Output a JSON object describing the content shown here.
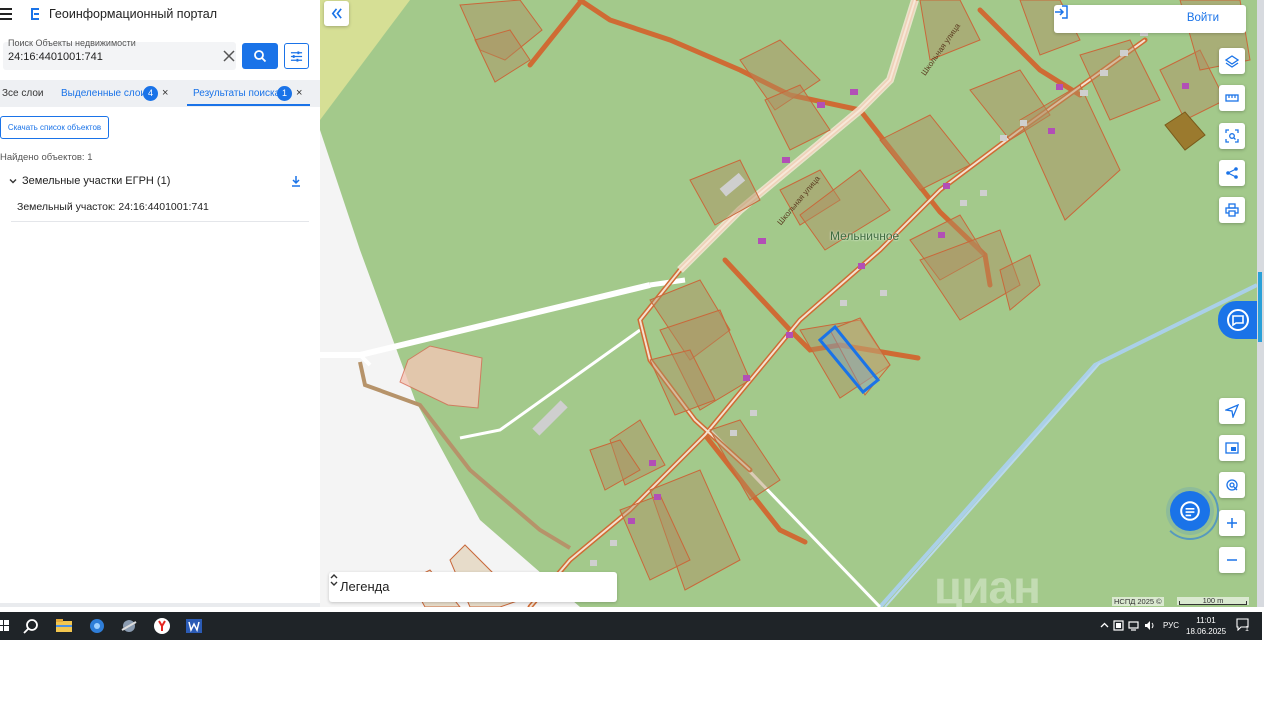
{
  "app": {
    "title": "Геоинформационный портал"
  },
  "search": {
    "label": "Поиск Объекты недвижимости",
    "value": "24:16:4401001:741"
  },
  "tabs": [
    {
      "label": "Зсе слои"
    },
    {
      "label": "Выделенные слои",
      "badge": "4"
    },
    {
      "label": "Результаты поиска",
      "badge": "1"
    }
  ],
  "results": {
    "download_list_label": "Скачать список объектов",
    "found_text": "Найдено объектов: 1",
    "group_label": "Земельные участки ЕГРН (1)",
    "items": [
      {
        "label": "Земельный участок: 24:16:4401001:741"
      }
    ]
  },
  "map": {
    "login_label": "Войти",
    "legend_label": "Легенда",
    "place_name": "Мельничное",
    "street_names": [
      "Школьная улица",
      "Школьная улица"
    ],
    "attribution": "НСПД 2025 ©",
    "scale_label": "100 m",
    "watermark": "циан",
    "tools": [
      "layers-icon",
      "ruler-icon",
      "select-area-icon",
      "share-icon",
      "print-icon",
      "locate-icon",
      "minimap-icon",
      "geo-search-icon",
      "zoom-in-icon",
      "zoom-out-icon"
    ],
    "colors": {
      "accent": "#1a73e8",
      "vegetation": "#a3c98b",
      "parcel": "#c9814f",
      "road": "#d0703e",
      "selected": "#1a73e8"
    }
  },
  "taskbar": {
    "language": "РУС",
    "time": "11:01",
    "date": "18.06.2025",
    "notifications": "1"
  }
}
